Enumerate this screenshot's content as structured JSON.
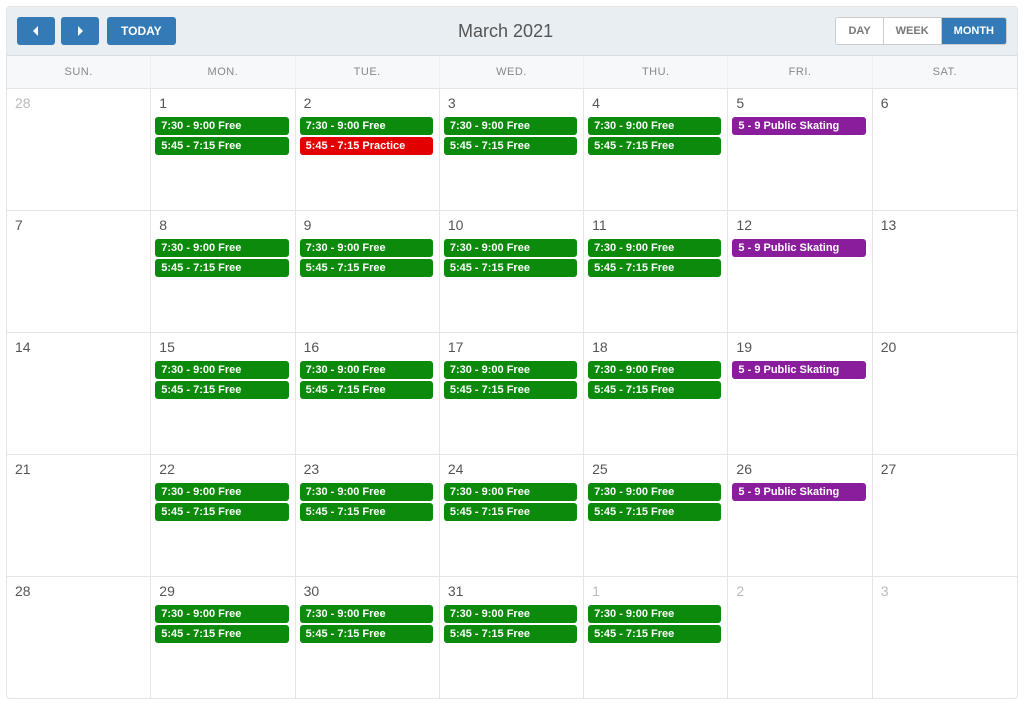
{
  "toolbar": {
    "today_label": "TODAY",
    "title": "March 2021",
    "views": {
      "day": "DAY",
      "week": "WEEK",
      "month": "MONTH",
      "active": "month"
    }
  },
  "day_headers": [
    "SUN.",
    "MON.",
    "TUE.",
    "WED.",
    "THU.",
    "FRI.",
    "SAT."
  ],
  "colors": {
    "free": "#0b8a0b",
    "practice": "#e30000",
    "public": "#8a1d9c"
  },
  "weeks": [
    [
      {
        "day": "28",
        "other": true,
        "events": []
      },
      {
        "day": "1",
        "events": [
          {
            "label": "7:30 - 9:00 Free",
            "type": "green"
          },
          {
            "label": "5:45 - 7:15 Free",
            "type": "green"
          }
        ]
      },
      {
        "day": "2",
        "events": [
          {
            "label": "7:30 - 9:00 Free",
            "type": "green"
          },
          {
            "label": "5:45 - 7:15 Practice",
            "type": "red"
          }
        ]
      },
      {
        "day": "3",
        "events": [
          {
            "label": "7:30 - 9:00 Free",
            "type": "green"
          },
          {
            "label": "5:45 - 7:15 Free",
            "type": "green"
          }
        ]
      },
      {
        "day": "4",
        "events": [
          {
            "label": "7:30 - 9:00 Free",
            "type": "green"
          },
          {
            "label": "5:45 - 7:15 Free",
            "type": "green"
          }
        ]
      },
      {
        "day": "5",
        "events": [
          {
            "label": "5 - 9 Public Skating",
            "type": "purple"
          }
        ]
      },
      {
        "day": "6",
        "events": []
      }
    ],
    [
      {
        "day": "7",
        "events": []
      },
      {
        "day": "8",
        "events": [
          {
            "label": "7:30 - 9:00 Free",
            "type": "green"
          },
          {
            "label": "5:45 - 7:15 Free",
            "type": "green"
          }
        ]
      },
      {
        "day": "9",
        "events": [
          {
            "label": "7:30 - 9:00 Free",
            "type": "green"
          },
          {
            "label": "5:45 - 7:15 Free",
            "type": "green"
          }
        ]
      },
      {
        "day": "10",
        "events": [
          {
            "label": "7:30 - 9:00 Free",
            "type": "green"
          },
          {
            "label": "5:45 - 7:15 Free",
            "type": "green"
          }
        ]
      },
      {
        "day": "11",
        "events": [
          {
            "label": "7:30 - 9:00 Free",
            "type": "green"
          },
          {
            "label": "5:45 - 7:15 Free",
            "type": "green"
          }
        ]
      },
      {
        "day": "12",
        "events": [
          {
            "label": "5 - 9 Public Skating",
            "type": "purple"
          }
        ]
      },
      {
        "day": "13",
        "events": []
      }
    ],
    [
      {
        "day": "14",
        "events": []
      },
      {
        "day": "15",
        "events": [
          {
            "label": "7:30 - 9:00 Free",
            "type": "green"
          },
          {
            "label": "5:45 - 7:15 Free",
            "type": "green"
          }
        ]
      },
      {
        "day": "16",
        "events": [
          {
            "label": "7:30 - 9:00 Free",
            "type": "green"
          },
          {
            "label": "5:45 - 7:15 Free",
            "type": "green"
          }
        ]
      },
      {
        "day": "17",
        "events": [
          {
            "label": "7:30 - 9:00 Free",
            "type": "green"
          },
          {
            "label": "5:45 - 7:15 Free",
            "type": "green"
          }
        ]
      },
      {
        "day": "18",
        "events": [
          {
            "label": "7:30 - 9:00 Free",
            "type": "green"
          },
          {
            "label": "5:45 - 7:15 Free",
            "type": "green"
          }
        ]
      },
      {
        "day": "19",
        "events": [
          {
            "label": "5 - 9 Public Skating",
            "type": "purple"
          }
        ]
      },
      {
        "day": "20",
        "events": []
      }
    ],
    [
      {
        "day": "21",
        "events": []
      },
      {
        "day": "22",
        "events": [
          {
            "label": "7:30 - 9:00 Free",
            "type": "green"
          },
          {
            "label": "5:45 - 7:15 Free",
            "type": "green"
          }
        ]
      },
      {
        "day": "23",
        "events": [
          {
            "label": "7:30 - 9:00 Free",
            "type": "green"
          },
          {
            "label": "5:45 - 7:15 Free",
            "type": "green"
          }
        ]
      },
      {
        "day": "24",
        "events": [
          {
            "label": "7:30 - 9:00 Free",
            "type": "green"
          },
          {
            "label": "5:45 - 7:15 Free",
            "type": "green"
          }
        ]
      },
      {
        "day": "25",
        "events": [
          {
            "label": "7:30 - 9:00 Free",
            "type": "green"
          },
          {
            "label": "5:45 - 7:15 Free",
            "type": "green"
          }
        ]
      },
      {
        "day": "26",
        "events": [
          {
            "label": "5 - 9 Public Skating",
            "type": "purple"
          }
        ]
      },
      {
        "day": "27",
        "events": []
      }
    ],
    [
      {
        "day": "28",
        "events": []
      },
      {
        "day": "29",
        "events": [
          {
            "label": "7:30 - 9:00 Free",
            "type": "green"
          },
          {
            "label": "5:45 - 7:15 Free",
            "type": "green"
          }
        ]
      },
      {
        "day": "30",
        "events": [
          {
            "label": "7:30 - 9:00 Free",
            "type": "green"
          },
          {
            "label": "5:45 - 7:15 Free",
            "type": "green"
          }
        ]
      },
      {
        "day": "31",
        "events": [
          {
            "label": "7:30 - 9:00 Free",
            "type": "green"
          },
          {
            "label": "5:45 - 7:15 Free",
            "type": "green"
          }
        ]
      },
      {
        "day": "1",
        "other": true,
        "events": [
          {
            "label": "7:30 - 9:00 Free",
            "type": "green"
          },
          {
            "label": "5:45 - 7:15 Free",
            "type": "green"
          }
        ]
      },
      {
        "day": "2",
        "other": true,
        "events": []
      },
      {
        "day": "3",
        "other": true,
        "events": []
      }
    ]
  ]
}
